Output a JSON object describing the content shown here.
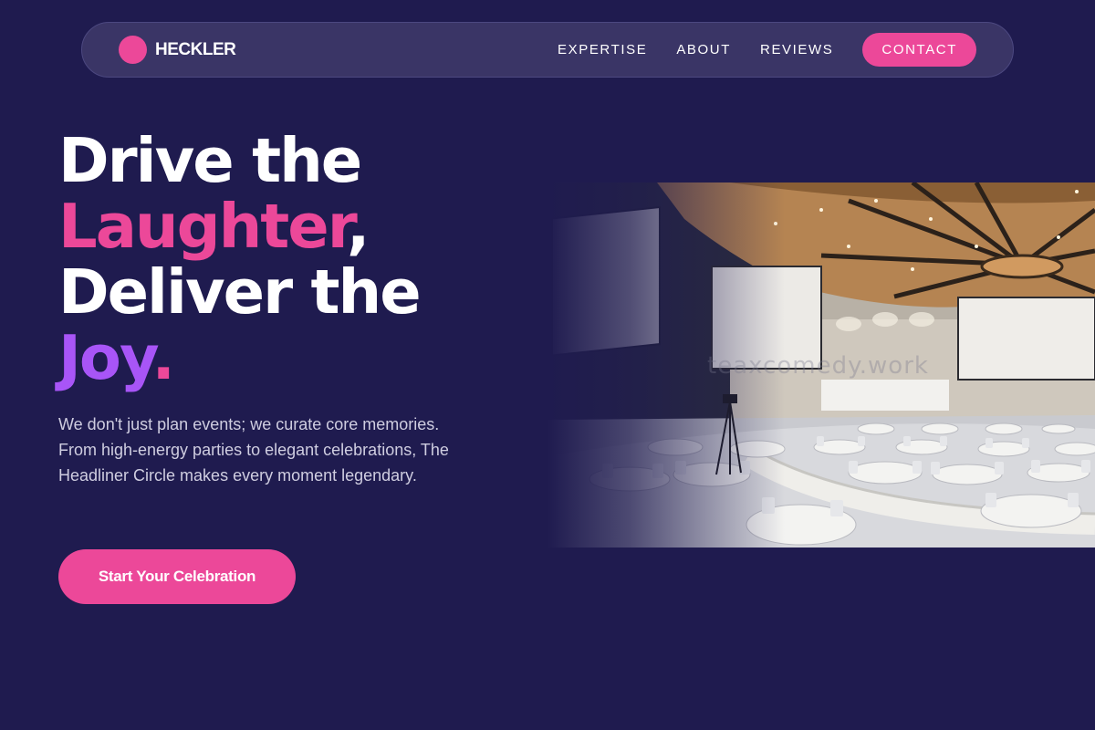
{
  "brand": {
    "name": "HECKLER",
    "accent": "#ec4899"
  },
  "nav": {
    "links": [
      "EXPERTISE",
      "ABOUT",
      "REVIEWS"
    ],
    "cta": "CONTACT"
  },
  "hero": {
    "title": {
      "line1": "Drive the",
      "line2_word": "Laughter",
      "line2_punct": ",",
      "line3": "Deliver the",
      "line4_word": "Joy",
      "line4_punct": "."
    },
    "subtitle": "We don't just plan events; we curate core memories. From high-energy parties to elegant celebrations, The Headliner Circle makes every moment legendary.",
    "cta": "Start Your Celebration",
    "image_watermark": "teaxcomedy.work"
  },
  "colors": {
    "background": "#1f1b4f",
    "nav_background": "#3a3566",
    "pink": "#ec4899",
    "purple": "#a855f7",
    "subtitle_text": "#cfcde0"
  }
}
